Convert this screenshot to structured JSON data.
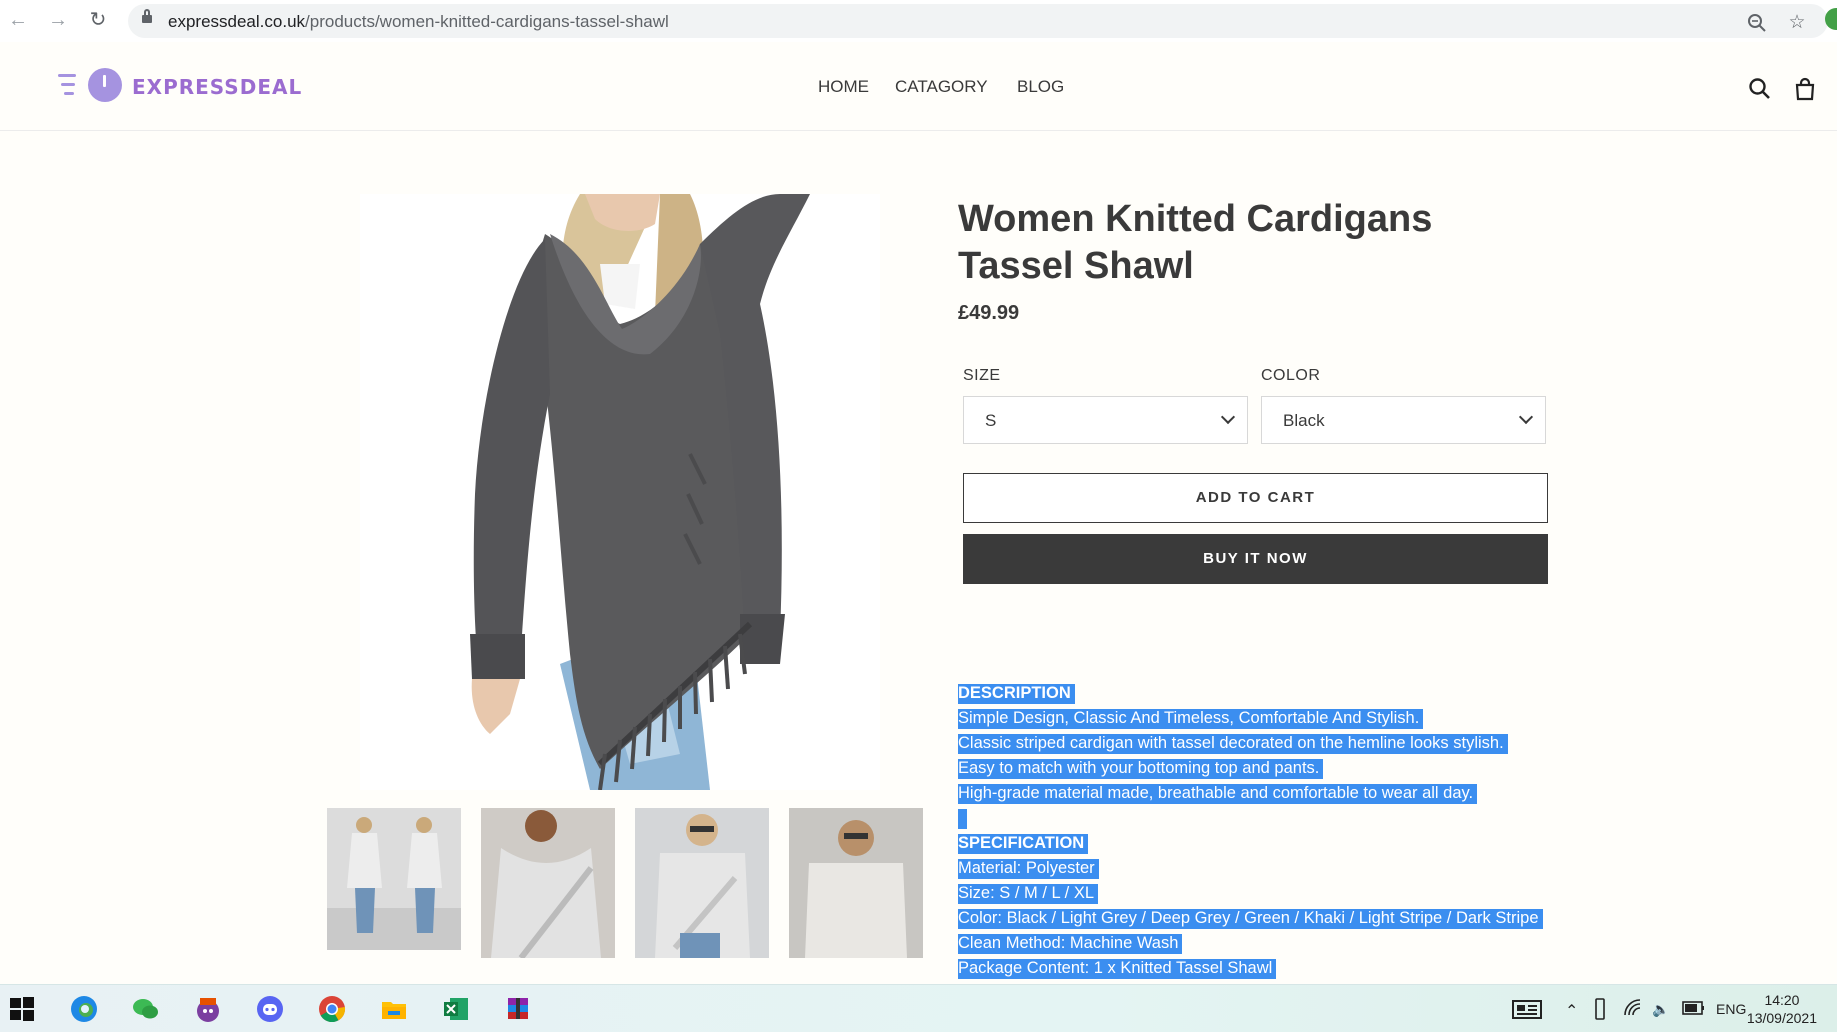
{
  "browser": {
    "url_domain": "expressdeal.co.uk",
    "url_path": "/products/women-knitted-cardigans-tassel-shawl"
  },
  "header": {
    "logo_text": "EXPRESSDEAL",
    "nav": [
      "HOME",
      "CATAGORY",
      "BLOG"
    ],
    "icons": [
      "search-icon",
      "cart-icon"
    ]
  },
  "product": {
    "title": "Women Knitted Cardigans Tassel Shawl",
    "price": "£49.99",
    "size_label": "SIZE",
    "size_value": "S",
    "color_label": "COLOR",
    "color_value": "Black",
    "add_to_cart": "ADD TO CART",
    "buy_now": "BUY IT NOW",
    "thumbnails": 4
  },
  "description": {
    "heading": "DESCRIPTION",
    "lines": [
      "Simple Design, Classic And Timeless, Comfortable And Stylish.",
      "Classic striped cardigan with tassel decorated on the hemline looks stylish.",
      "Easy to match with your bottoming top and pants.",
      "High-grade material made, breathable and comfortable to wear all day."
    ],
    "spec_heading": "SPECIFICATION",
    "spec_lines": [
      "Material: Polyester",
      "Size: S / M / L / XL",
      "Color: Black / Light Grey / Deep Grey / Green / Khaki / Light Stripe / Dark Stripe",
      "Clean Method: Machine Wash",
      "Package Content: 1 x Knitted Tassel Shawl"
    ],
    "selection_color": "#3b8ef0"
  },
  "taskbar": {
    "apps": [
      "edge-icon",
      "wechat-icon",
      "bonzi-icon",
      "discord-icon",
      "chrome-icon",
      "file-explorer-icon",
      "excel-icon",
      "winrar-icon"
    ],
    "language": "ENG",
    "time": "14:20",
    "date": "13/09/2021"
  }
}
